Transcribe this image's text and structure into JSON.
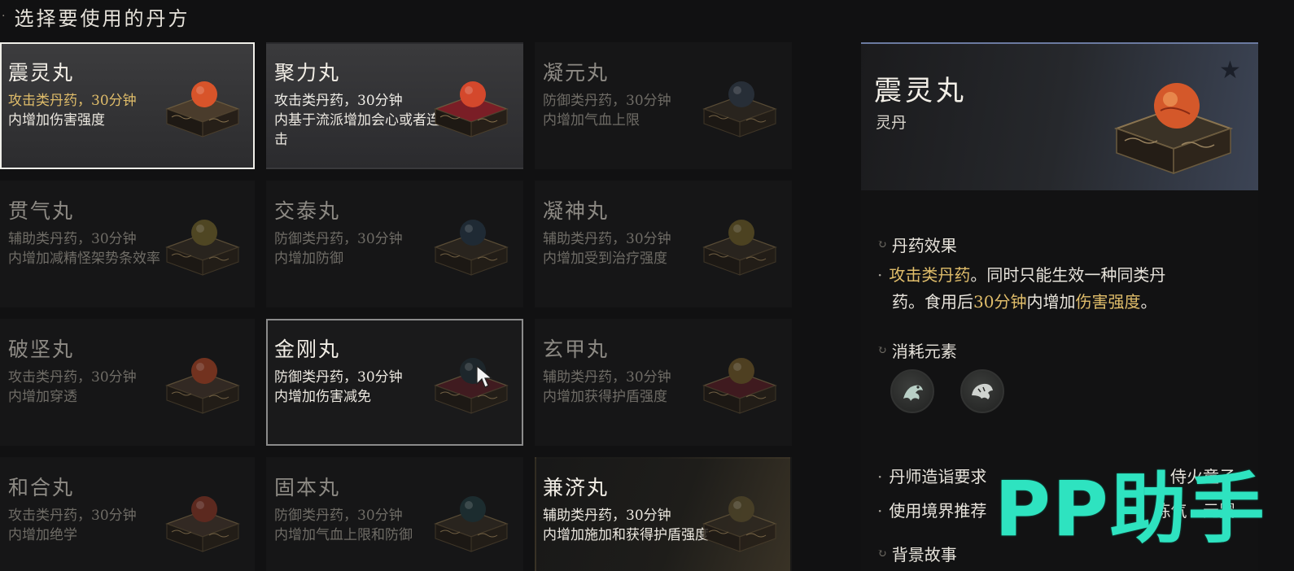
{
  "header": {
    "title": "选择要使用的丹方"
  },
  "cards": [
    {
      "name": "震灵丸",
      "type": "攻击类丹药，30分钟",
      "desc": "内增加伤害强度",
      "pill_color": "#d8542a",
      "box_color": "#4a3c2c",
      "state": "selected"
    },
    {
      "name": "聚力丸",
      "type": "攻击类丹药，30分钟",
      "desc": "内基于流派增加会心或者连击",
      "pill_color": "#d4482c",
      "box_color": "#7a1e26",
      "state": "active"
    },
    {
      "name": "凝元丸",
      "type": "防御类丹药，30分钟",
      "desc": "内增加气血上限",
      "pill_color": "#2c3540",
      "box_color": "#2e2820",
      "state": "dim"
    },
    {
      "name": "贯气丸",
      "type": "辅助类丹药，30分钟",
      "desc": "内增加减精怪架势条效率",
      "pill_color": "#5e5226",
      "box_color": "#2e2820",
      "state": "dim"
    },
    {
      "name": "交泰丸",
      "type": "防御类丹药，30分钟",
      "desc": "内增加防御",
      "pill_color": "#22303c",
      "box_color": "#2e2820",
      "state": "dim"
    },
    {
      "name": "凝神丸",
      "type": "辅助类丹药，30分钟",
      "desc": "内增加受到治疗强度",
      "pill_color": "#5a4e24",
      "box_color": "#2e2820",
      "state": "dim"
    },
    {
      "name": "破坚丸",
      "type": "攻击类丹药，30分钟",
      "desc": "内增加穿透",
      "pill_color": "#8a3a22",
      "box_color": "#3a2e26",
      "state": "dim"
    },
    {
      "name": "金刚丸",
      "type": "防御类丹药，30分钟",
      "desc": "内增加伤害减免",
      "pill_color": "#1e2a30",
      "box_color": "#4a1c22",
      "state": "hovered"
    },
    {
      "name": "玄甲丸",
      "type": "辅助类丹药，30分钟",
      "desc": "内增加获得护盾强度",
      "pill_color": "#5c4a24",
      "box_color": "#4a1c22",
      "state": "dim"
    },
    {
      "name": "和合丸",
      "type": "攻击类丹药，30分钟",
      "desc": "内增加绝学",
      "pill_color": "#6e2e22",
      "box_color": "#3a2e26",
      "state": "dim"
    },
    {
      "name": "固本丸",
      "type": "防御类丹药，30分钟",
      "desc": "内增加气血上限和防御",
      "pill_color": "#1e3236",
      "box_color": "#2e2820",
      "state": "dim"
    },
    {
      "name": "兼济丸",
      "type": "辅助类丹药，30分钟",
      "desc": "内增加施加和获得护盾强度",
      "pill_color": "#4e4428",
      "box_color": "#2e2820",
      "state": "glow"
    }
  ],
  "detail": {
    "title": "震灵丸",
    "subtitle": "灵丹",
    "star_icon": "star-icon",
    "effect_section": "丹药效果",
    "effect_bullet": "·",
    "effect_highlight_type": "攻击类丹药",
    "effect_text_1": "。同时只能生效一种同类丹",
    "effect_text_2": "药。食用后",
    "effect_highlight_time": "30分钟",
    "effect_text_3": "内增加",
    "effect_highlight_stat": "伤害强度",
    "effect_text_4": "。",
    "consume_section": "消耗元素",
    "elements": [
      "dragon-element-icon",
      "tiger-element-icon"
    ],
    "requirements": [
      {
        "label": "丹师造诣要求",
        "value": "侍火童子"
      },
      {
        "label": "使用境界推荐",
        "value": "练气 - 元婴"
      }
    ],
    "story_section": "背景故事"
  },
  "watermark": "PP助手"
}
